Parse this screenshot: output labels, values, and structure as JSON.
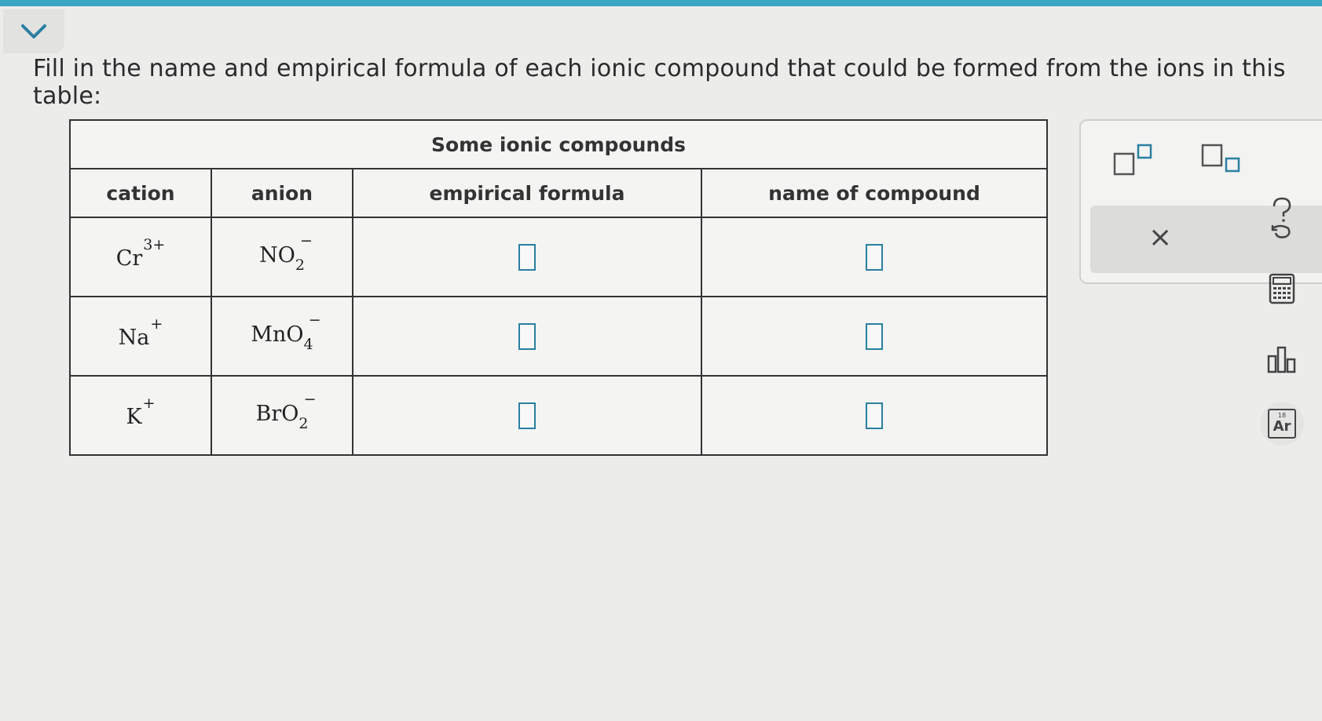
{
  "prompt": "Fill in the name and empirical formula of each ionic compound that could be formed from the ions in this table:",
  "table": {
    "title": "Some ionic compounds",
    "headers": {
      "cation": "cation",
      "anion": "anion",
      "formula": "empirical formula",
      "name": "name of compound"
    },
    "rows": [
      {
        "cation": {
          "symbol": "Cr",
          "charge": "3+"
        },
        "anion": {
          "symbol": "NO",
          "sub": "2",
          "charge": "−"
        }
      },
      {
        "cation": {
          "symbol": "Na",
          "charge": "+"
        },
        "anion": {
          "symbol": "MnO",
          "sub": "4",
          "charge": "−"
        }
      },
      {
        "cation": {
          "symbol": "K",
          "charge": "+"
        },
        "anion": {
          "symbol": "BrO",
          "sub": "2",
          "charge": "−"
        }
      }
    ]
  },
  "palette": {
    "buttons": [
      "superscript-icon",
      "subscript-icon"
    ],
    "clear_label": "×"
  },
  "side_tools": {
    "icons": [
      "help-icon",
      "calculator-icon",
      "chart-icon",
      "periodic-table-icon"
    ],
    "periodic_number": "18",
    "periodic_symbol": "Ar"
  },
  "colors": {
    "accent": "#2a7fa0",
    "top_bar": "#3aa6c2"
  }
}
